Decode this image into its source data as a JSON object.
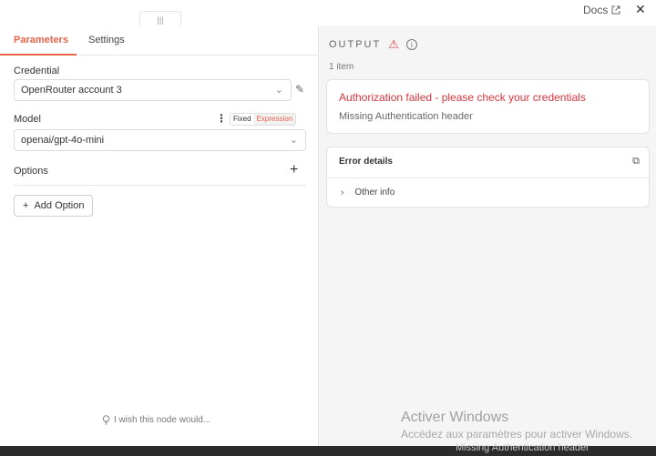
{
  "topbar": {
    "drag_handle": "|||",
    "docs_label": "Docs",
    "close_label": "✕"
  },
  "tabs": [
    {
      "label": "Parameters",
      "active": true
    },
    {
      "label": "Settings",
      "active": false
    }
  ],
  "credential": {
    "label": "Credential",
    "value": "OpenRouter account 3"
  },
  "model": {
    "label": "Model",
    "value": "openai/gpt-4o-mini",
    "mode_fixed": "Fixed",
    "mode_expression": "Expression"
  },
  "options": {
    "label": "Options",
    "add_button": "Add Option"
  },
  "feedback": {
    "label": "I wish this node would..."
  },
  "output": {
    "title": "OUTPUT",
    "count": "1 item",
    "error_title": "Authorization failed - please check your credentials",
    "error_message": "Missing Authentication header",
    "details_title": "Error details",
    "other_info": "Other info"
  },
  "watermark": {
    "line1": "Activer Windows",
    "line2": "Accédez aux paramètres pour activer Windows."
  },
  "underlay_text": "Missing Authentication header",
  "colors": {
    "accent": "#e8644a",
    "error": "#d9363e"
  }
}
